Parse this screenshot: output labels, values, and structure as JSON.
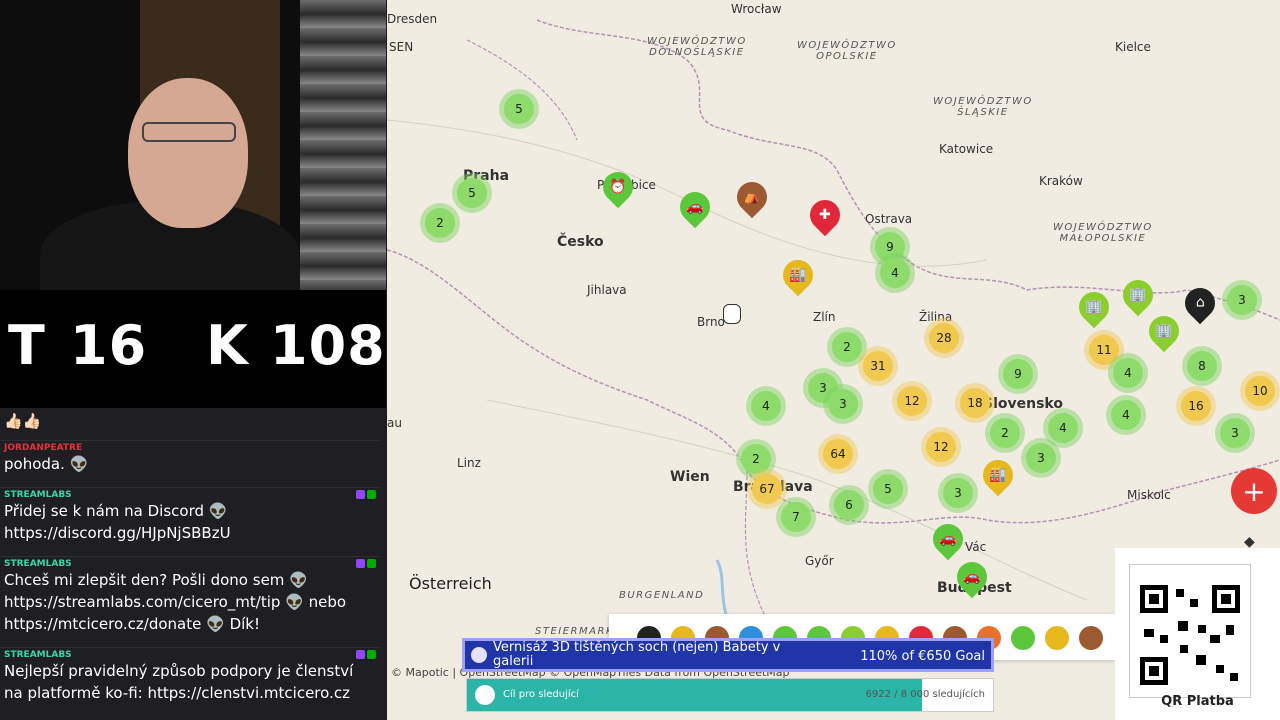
{
  "counter": {
    "t_label": "T",
    "t_value": "16",
    "k_label": "K",
    "k_value": "108"
  },
  "chat": {
    "messages": [
      {
        "user": "",
        "text": "👍🏻👍🏻",
        "user_color": "#ffffff"
      },
      {
        "user": "JORDANPEATRE",
        "text": "pohoda. 👽",
        "user_color": "#e3343b"
      },
      {
        "user": "STREAMLABS",
        "text": "Přidej se k nám na Discord 👽 https://discord.gg/HJpNjSBBzU",
        "user_color": "#3cd7a1"
      },
      {
        "user": "STREAMLABS",
        "text": "Chceš mi zlepšit den? Pošli dono sem 👽 https://streamlabs.com/cicero_mt/tip 👽 nebo https://mtcicero.cz/donate 👽 Dík!",
        "user_color": "#3cd7a1"
      },
      {
        "user": "STREAMLABS",
        "text": "Nejlepší pravidelný způsob podpory je členství na platformě ko-fi: https://clenstvi.mtcicero.cz",
        "user_color": "#3cd7a1"
      }
    ]
  },
  "map": {
    "labels": {
      "dresden": "Dresden",
      "wroclaw": "Wrocław",
      "kielce": "Kielce",
      "katowice": "Katowice",
      "krakow": "Kraków",
      "praha": "Praha",
      "pardubice": "Pardubice",
      "cesko": "Česko",
      "jihlava": "Jihlava",
      "brno": "Brno",
      "ostrava": "Ostrava",
      "zlin": "Zlín",
      "zilina": "Žilina",
      "slovensko": "Slovensko",
      "linz": "Linz",
      "wien": "Wien",
      "bratislava": "Bratislava",
      "gyor": "Győr",
      "vac": "Vác",
      "budapest": "Budapest",
      "miskolc": "Miskolc",
      "osterreich": "Österreich",
      "burgenland": "BURGENLAND",
      "steiermark": "STEIERMARK",
      "sen": "SEN",
      "au": "au"
    },
    "regions": {
      "dolnoslaskie": "WOJEWÓDZTWO\nDOLNOŚLĄSKIE",
      "opolskie": "WOJEWÓDZTWO\nOPOLSKIE",
      "slaskie": "WOJEWÓDZTWO\nŚLĄSKIE",
      "malopolskie": "WOJEWÓDZTWO\nMAŁOPOLSKIE"
    },
    "clusters": {
      "c1": "5",
      "c2": "5",
      "c3": "2",
      "c4": "9",
      "c5": "4",
      "c6": "28",
      "c7": "2",
      "c8": "31",
      "c9": "11",
      "c10": "4",
      "c11": "8",
      "c12": "3",
      "c13": "10",
      "c14": "9",
      "c15": "3",
      "c16": "3",
      "c17": "12",
      "c18": "18",
      "c19": "4",
      "c20": "16",
      "c21": "4",
      "c22": "4",
      "c23": "3",
      "c24": "2",
      "c25": "12",
      "c26": "64",
      "c27": "2",
      "c28": "3",
      "c29": "67",
      "c30": "5",
      "c31": "6",
      "c32": "7",
      "c33": "3"
    },
    "attribution": "© Mapotic | OpenStreetMap © OpenMapTiles Data from OpenStreetMap",
    "add_button": "+"
  },
  "qr": {
    "label": "QR Platba"
  },
  "goal": {
    "title": "Vernisáž 3D tištěných soch (nejen) Babety v galerii",
    "value": "110% of €650 Goal"
  },
  "follower_goal": {
    "label": "Cíl pro sledující",
    "value": "6922 / 8 000 sledujících",
    "progress": 0.865
  },
  "colors": {
    "green": "#8ddb6b",
    "yellow": "#f0c94e",
    "red_button": "#e53935",
    "goal_bg": "#1f35a8",
    "follow_fill": "#2bb5a8"
  }
}
